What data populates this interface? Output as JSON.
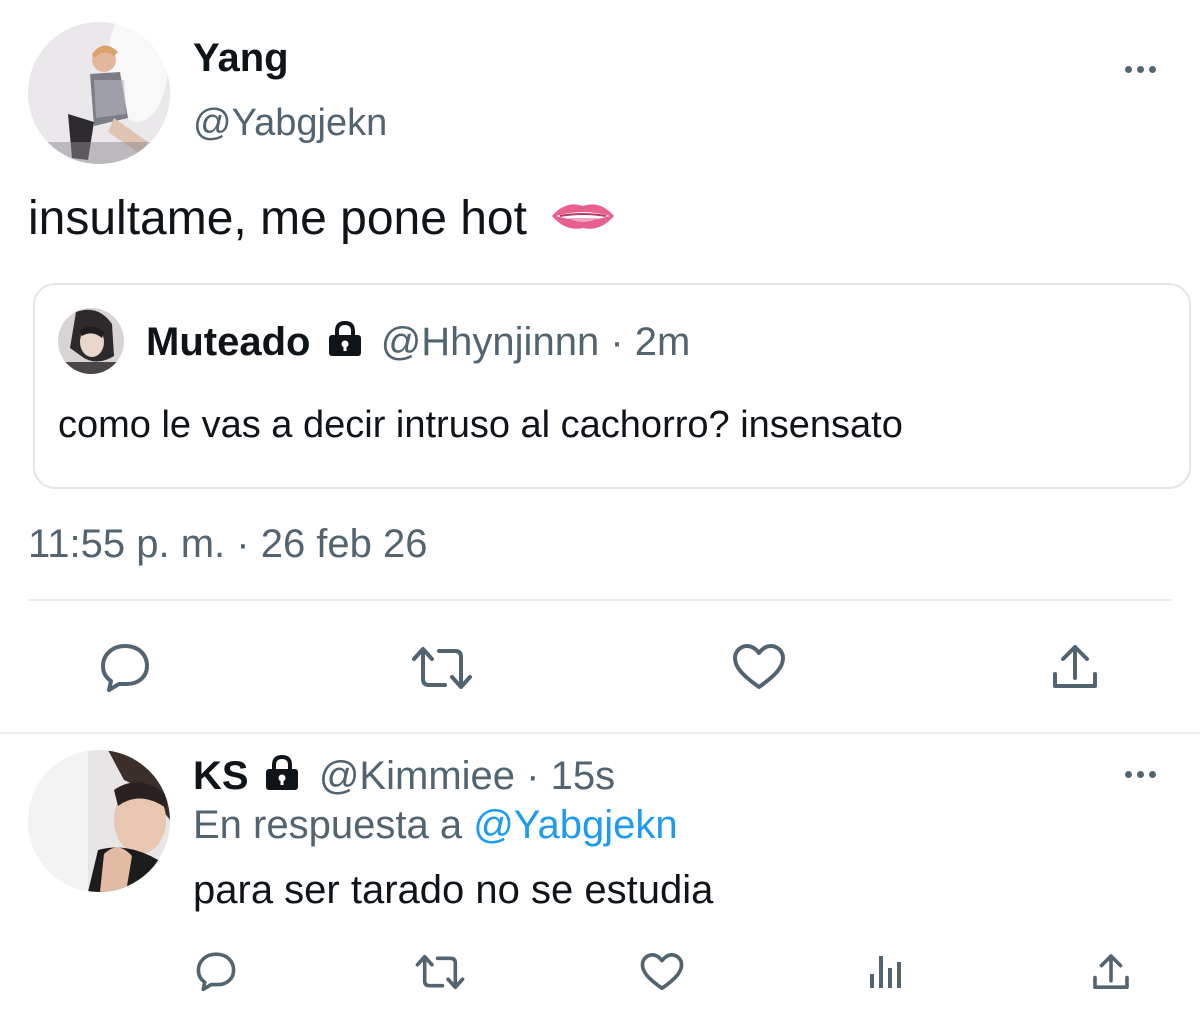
{
  "main_tweet": {
    "author_name": "Yang",
    "author_handle": "@Yabgjekn",
    "text": "insultame, me pone hot",
    "emoji": "🫦",
    "timestamp": "11:55 p. m. · 26 feb 26",
    "quoted": {
      "author_name": "Muteado",
      "author_handle": "@Hhynjinnn",
      "time": "· 2m",
      "text": "como le vas a decir intruso al cachorro? insensato"
    }
  },
  "reply": {
    "author_name": "KS",
    "author_handle": "@Kimmiee",
    "time": "· 15s",
    "reply_prefix": "En respuesta a",
    "reply_to": "@Yabgjekn",
    "text": "para ser tarado no se estudia"
  },
  "icons": {
    "more": "more-dots-icon",
    "lock": "lock-icon",
    "reply": "reply-icon",
    "retweet": "retweet-icon",
    "like": "heart-icon",
    "analytics": "analytics-icon",
    "share": "share-icon"
  },
  "colors": {
    "text": "#0f1419",
    "muted": "#536471",
    "link": "#1d9bf0",
    "border": "#cfd9de",
    "lips": "#e8608f"
  }
}
